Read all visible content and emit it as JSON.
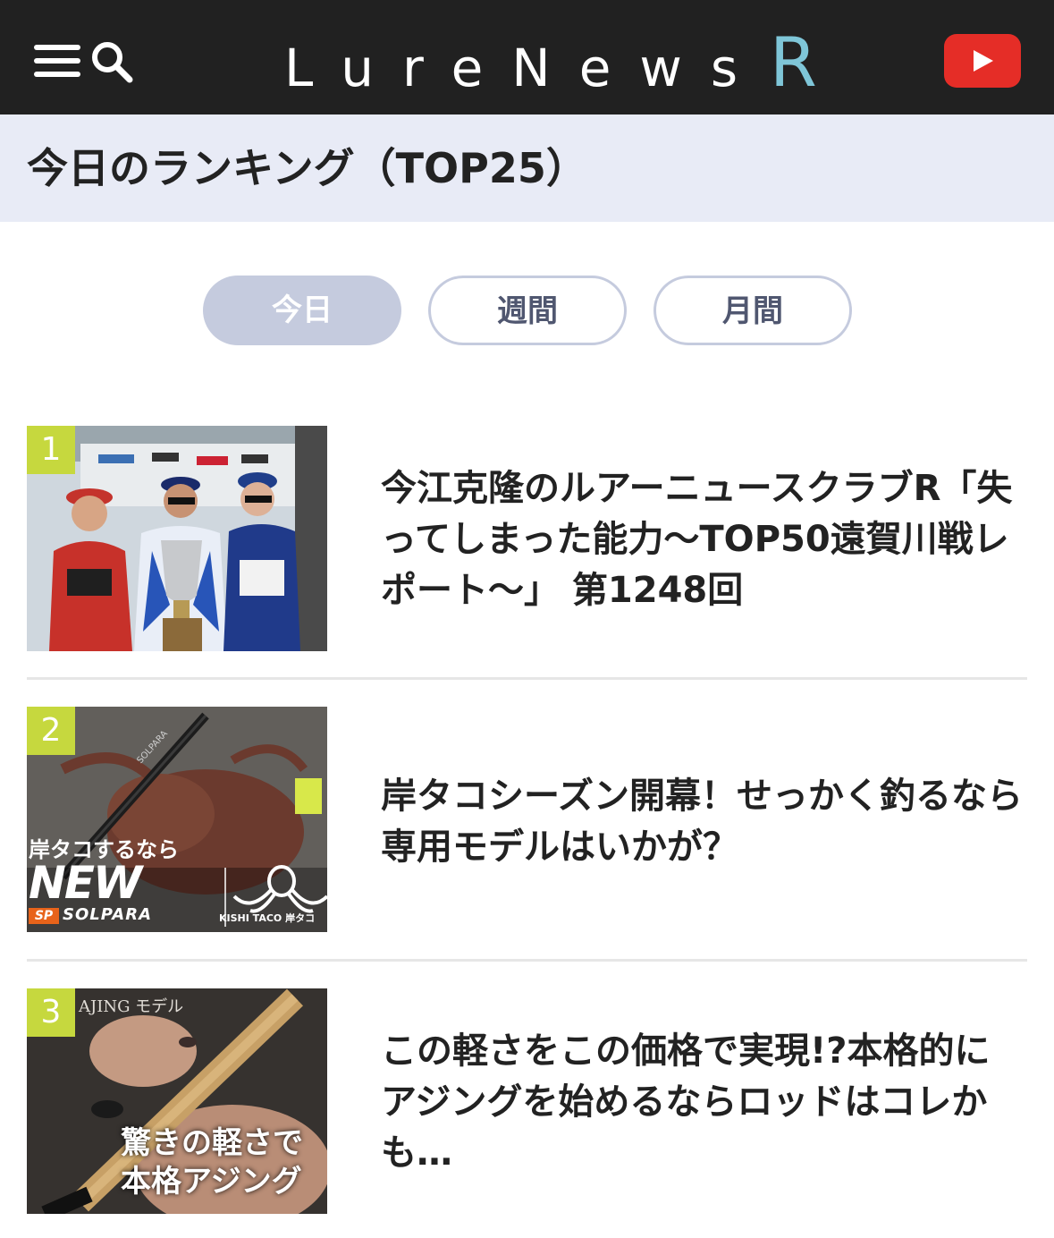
{
  "header": {
    "logo_main": "LureNews",
    "logo_accent": "R",
    "icons": [
      "menu-icon",
      "search-icon",
      "youtube-icon"
    ],
    "logo_accent_color": "#7fc6d8",
    "youtube_color": "#e52d27"
  },
  "page": {
    "title": "今日のランキング（TOP25）"
  },
  "tabs": [
    {
      "label": "今日",
      "active": true
    },
    {
      "label": "週間",
      "active": false
    },
    {
      "label": "月間",
      "active": false
    }
  ],
  "rankings": [
    {
      "rank": "1",
      "title": "今江克隆のルアーニュースクラブR「失ってしまった能力〜TOP50遠賀川戦レポート〜」 第1248回"
    },
    {
      "rank": "2",
      "title": "岸タコシーズン開幕！せっかく釣るなら専用モデルはいかが？",
      "thumb_text": {
        "line1": "岸タコするなら",
        "new": "NEW",
        "brand": "SOLPARA",
        "sp": "SP",
        "kishitaco": "KISHI TACO 岸タコ",
        "rod": "SOLPARA"
      }
    },
    {
      "rank": "3",
      "title": "この軽さをこの価格で実現!?本格的にアジングを始めるならロッドはコレかも…",
      "thumb_text": {
        "top": "AJING モデル",
        "line1": "驚きの軽さで",
        "line2": "本格アジング"
      }
    }
  ],
  "colors": {
    "header_bg": "#212121",
    "title_bar_bg": "#e8ebf6",
    "tab_active_bg": "#c5cbde",
    "rank_badge": "#c6d83e"
  }
}
